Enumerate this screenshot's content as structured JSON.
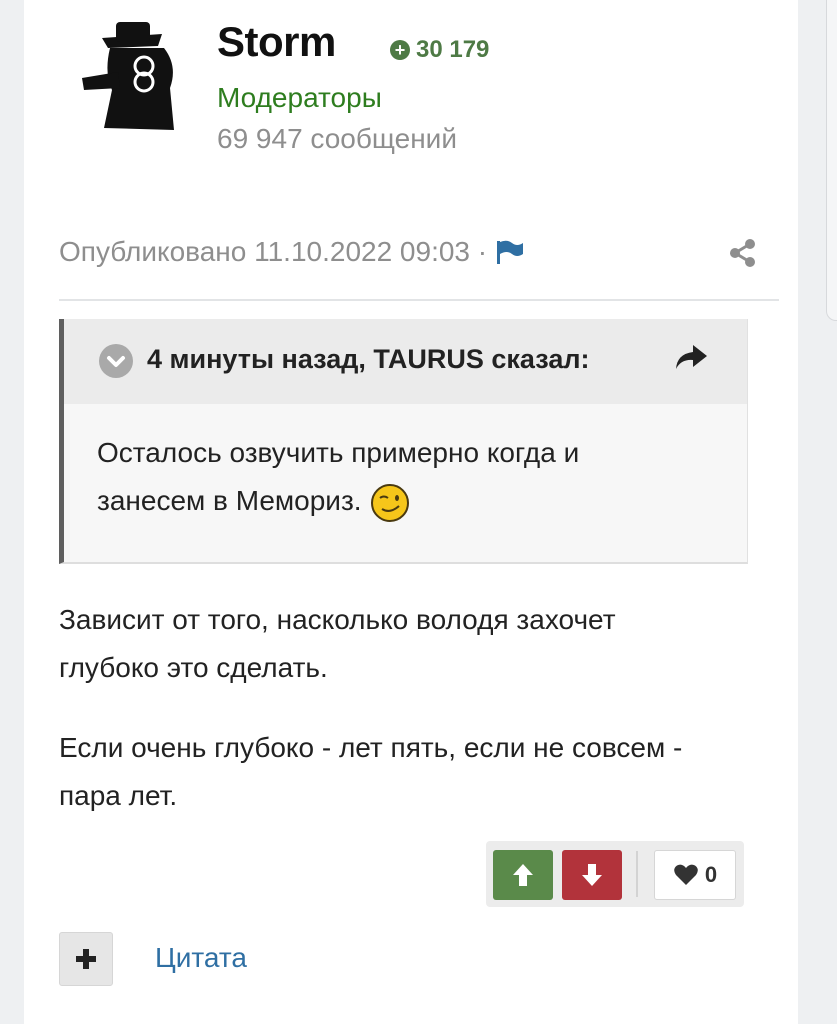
{
  "author": {
    "name": "Storm",
    "reputation": "30 179",
    "group": "Модераторы",
    "posts": "69 947 сообщений"
  },
  "meta": {
    "published": "Опубликовано 11.10.2022 09:03 ·"
  },
  "quote": {
    "citation": "4 минуты назад, TAURUS сказал:",
    "lines": [
      "Осталось озвучить примерно когда и",
      "занесем в Мемориз."
    ]
  },
  "post": {
    "paragraphs": [
      [
        "Зависит от того, насколько володя захочет",
        "глубоко это сделать."
      ],
      [
        "Если очень глубоко - лет пять, если не совсем -",
        "пара лет."
      ]
    ]
  },
  "reactions": {
    "likes": "0"
  },
  "footer": {
    "quote_label": "Цитата"
  },
  "colors": {
    "reputation": "#4e7a45",
    "group": "#2e7d1f",
    "upvote": "#5a8a4a",
    "downvote": "#b2333b",
    "link": "#2f6fa3"
  },
  "icons": [
    "avatar",
    "plus-circle-icon",
    "flag-icon",
    "share-icon",
    "chevron-down-icon",
    "reply-arrow-icon",
    "wink-emoji-icon",
    "arrow-up-icon",
    "arrow-down-icon",
    "heart-icon",
    "plus-icon"
  ]
}
